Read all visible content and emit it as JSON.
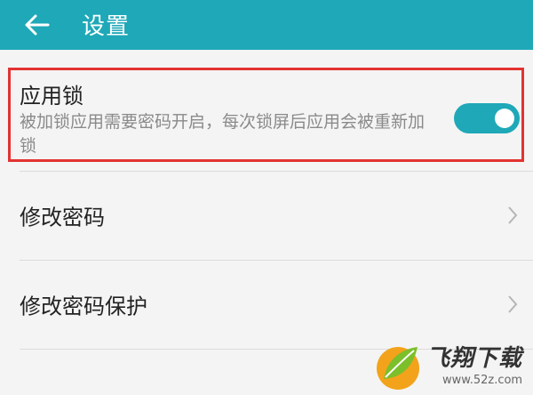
{
  "header": {
    "title": "设置",
    "back_icon": "arrow-left-icon",
    "background_color": "#1fa8b8"
  },
  "app_lock": {
    "title": "应用锁",
    "description": "被加锁应用需要密码开启，每次锁屏后应用会被重新加锁",
    "toggle_on": true,
    "highlight_color": "#e33232"
  },
  "menu": [
    {
      "label": "修改密码",
      "icon": "chevron-right-icon"
    },
    {
      "label": "修改密码保护",
      "icon": "chevron-right-icon"
    }
  ],
  "watermark": {
    "brand": "飞翔下载",
    "url": "www.52z.com"
  }
}
